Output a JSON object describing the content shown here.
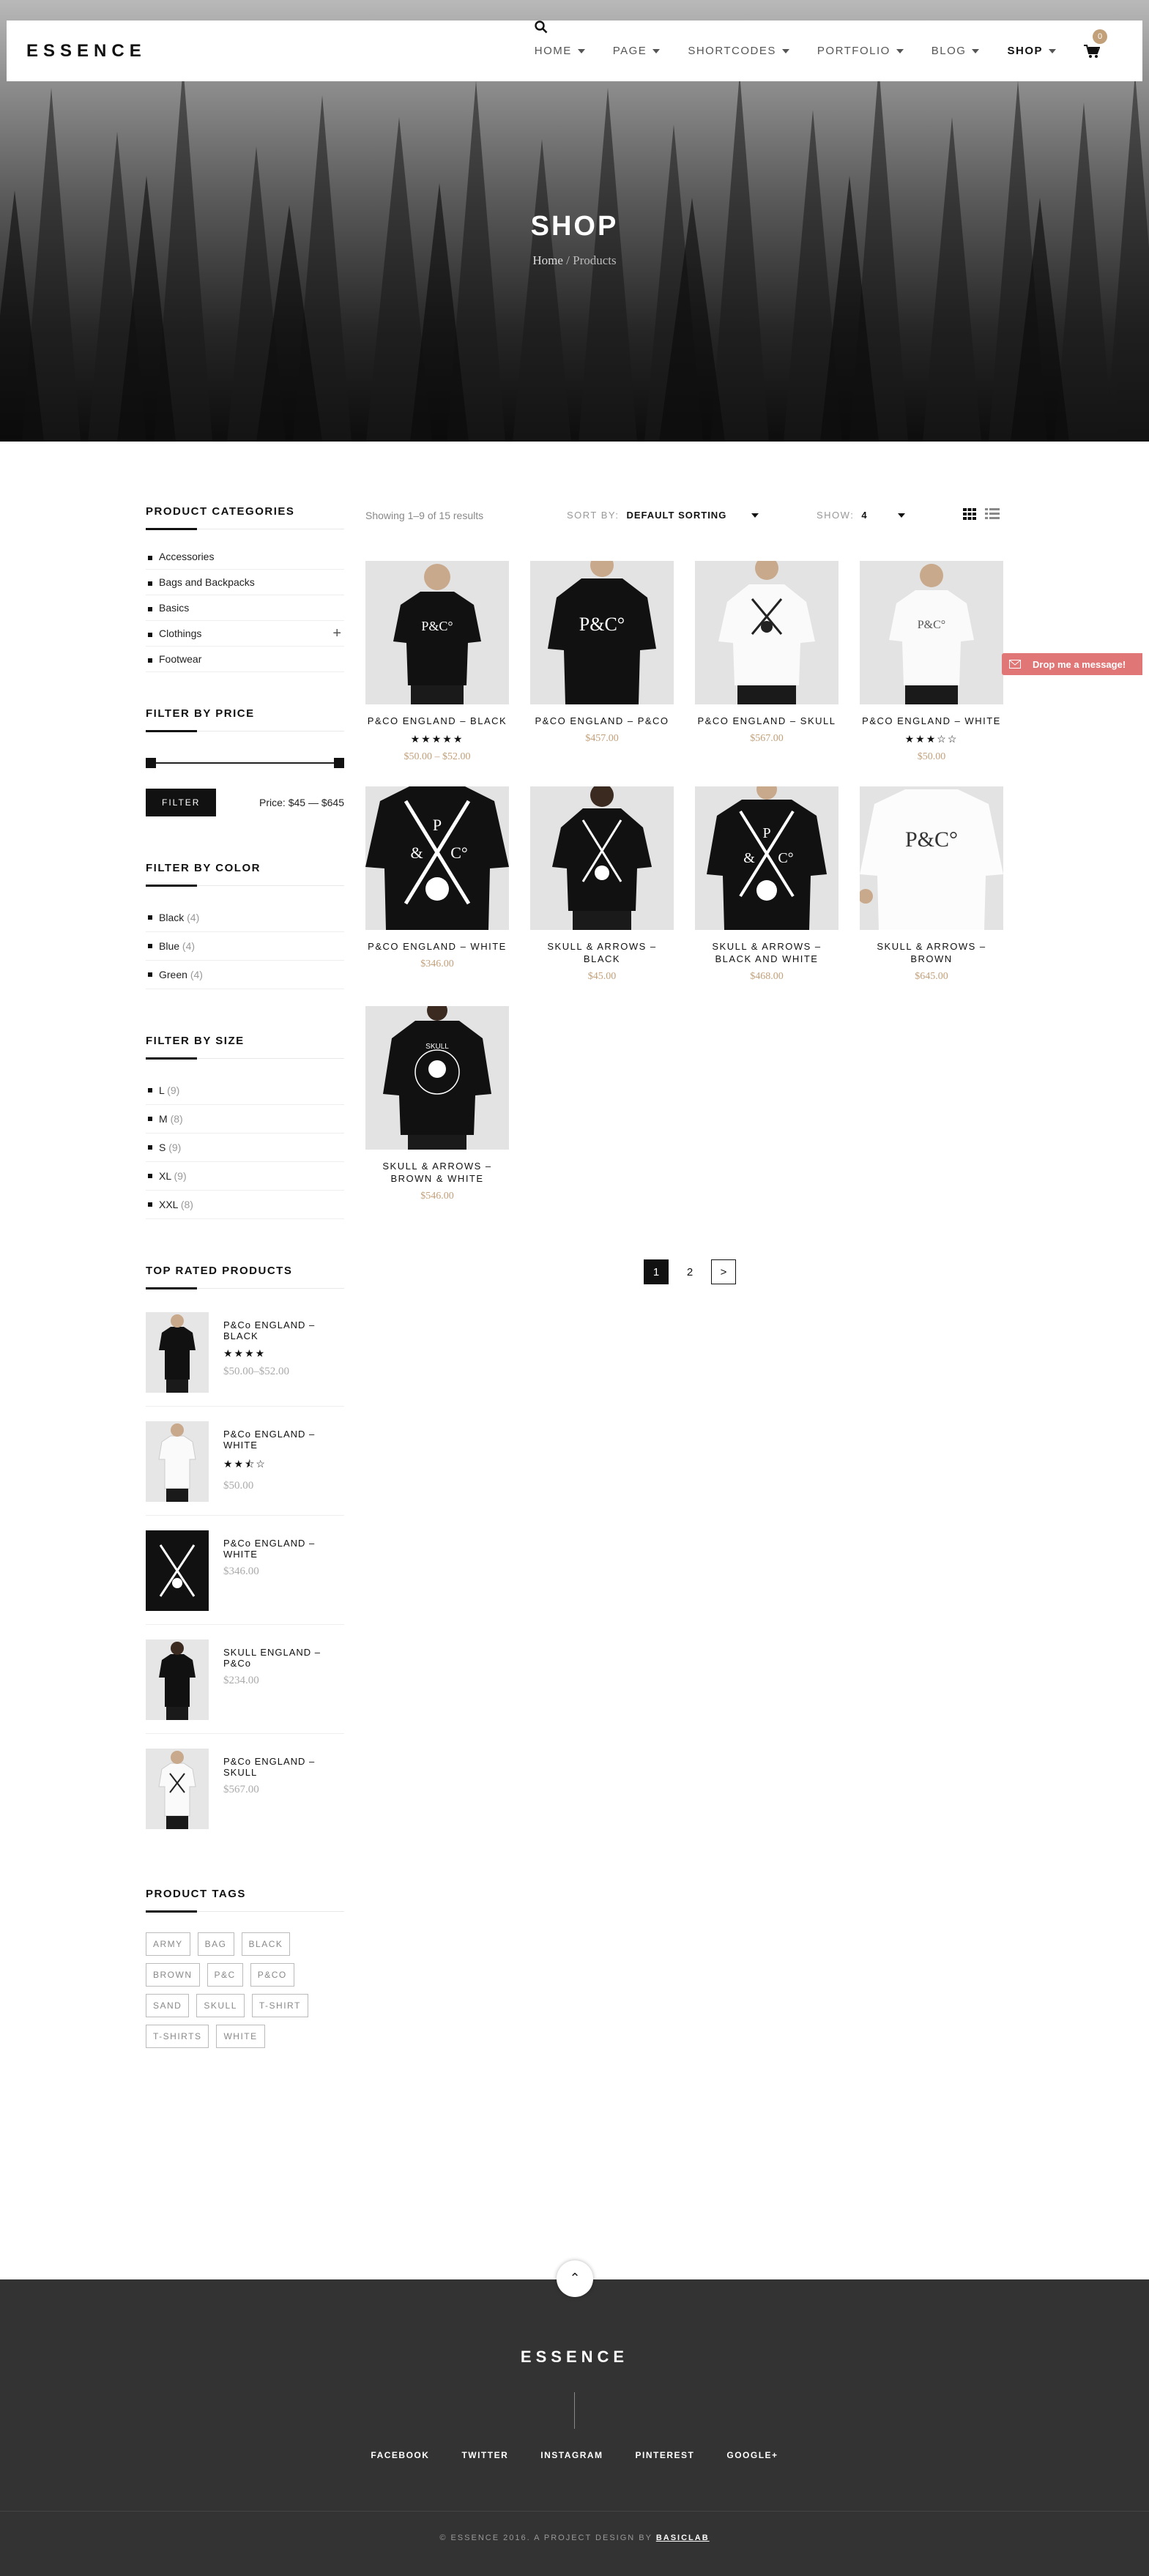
{
  "header": {
    "logo": "ESSENCE",
    "nav": [
      {
        "label": "HOME"
      },
      {
        "label": "PAGE"
      },
      {
        "label": "SHORTCODES"
      },
      {
        "label": "PORTFOLIO"
      },
      {
        "label": "BLOG"
      },
      {
        "label": "SHOP"
      }
    ],
    "cart_count": "0"
  },
  "hero": {
    "title": "SHOP",
    "breadcrumb_home": "Home",
    "breadcrumb_sep": "/",
    "breadcrumb_current": "Products"
  },
  "sidebar": {
    "categories_title": "PRODUCT CATEGORIES",
    "categories": [
      "Accessories",
      "Bags and Backpacks",
      "Basics",
      "Clothings",
      "Footwear"
    ],
    "price_title": "FILTER BY PRICE",
    "filter_button": "FILTER",
    "price_range": "Price: $45 — $645",
    "color_title": "FILTER BY COLOR",
    "colors": [
      {
        "name": "Black",
        "count": "(4)"
      },
      {
        "name": "Blue",
        "count": "(4)"
      },
      {
        "name": "Green",
        "count": "(4)"
      }
    ],
    "size_title": "FILTER BY SIZE",
    "sizes": [
      {
        "name": "L",
        "count": "(9)"
      },
      {
        "name": "M",
        "count": "(8)"
      },
      {
        "name": "S",
        "count": "(9)"
      },
      {
        "name": "XL",
        "count": "(9)"
      },
      {
        "name": "XXL",
        "count": "(8)"
      }
    ],
    "top_rated_title": "TOP RATED PRODUCTS",
    "top_rated": [
      {
        "name": "P&Co ENGLAND – BLACK",
        "stars": "★★★★",
        "price": "$50.00–$52.00"
      },
      {
        "name": "P&Co ENGLAND – WHITE",
        "stars": "★★⯪☆",
        "price": "$50.00"
      },
      {
        "name": "P&Co ENGLAND – WHITE",
        "stars": "",
        "price": "$346.00"
      },
      {
        "name": "SKULL ENGLAND – P&Co",
        "stars": "",
        "price": "$234.00"
      },
      {
        "name": "P&Co ENGLAND – SKULL",
        "stars": "",
        "price": "$567.00"
      }
    ],
    "tags_title": "PRODUCT TAGS",
    "tags": [
      "ARMY",
      "BAG",
      "BLACK",
      "BROWN",
      "P&C",
      "P&CO",
      "SAND",
      "SKULL",
      "T-SHIRT",
      "T-SHIRTS",
      "WHITE"
    ]
  },
  "toolbar": {
    "results": "Showing 1–9 of 15 results",
    "sort_label": "SORT BY:",
    "sort_value": "DEFAULT SORTING",
    "show_label": "SHOW:",
    "show_value": "4"
  },
  "products": [
    {
      "name": "P&CO ENGLAND – BLACK",
      "stars": "★★★★★",
      "price": "$50.00 – $52.00"
    },
    {
      "name": "P&CO ENGLAND – P&CO",
      "stars": "",
      "price": "$457.00"
    },
    {
      "name": "P&CO ENGLAND – SKULL",
      "stars": "",
      "price": "$567.00"
    },
    {
      "name": "P&CO ENGLAND – WHITE",
      "stars": "★★★☆☆",
      "price": "$50.00"
    },
    {
      "name": "P&CO ENGLAND – WHITE",
      "stars": "",
      "price": "$346.00"
    },
    {
      "name": "SKULL & ARROWS – BLACK",
      "stars": "",
      "price": "$45.00"
    },
    {
      "name": "SKULL & ARROWS – BLACK AND WHITE",
      "stars": "",
      "price": "$468.00"
    },
    {
      "name": "SKULL & ARROWS – BROWN",
      "stars": "",
      "price": "$645.00"
    },
    {
      "name": "SKULL & ARROWS – BROWN & WHITE",
      "stars": "",
      "price": "$546.00"
    }
  ],
  "pagination": {
    "page1": "1",
    "page2": "2",
    "next": ">"
  },
  "chat": {
    "label": "Drop me a message!"
  },
  "footer": {
    "logo": "ESSENCE",
    "social": [
      "FACEBOOK",
      "TWITTER",
      "INSTAGRAM",
      "PINTEREST",
      "GOOGLE+"
    ],
    "copyright": "© ESSENCE 2016. A PROJECT DESIGN BY",
    "designer": "BASICLAB"
  },
  "colors": {
    "accent": "#c2a07a",
    "chat": "#e07676",
    "footer": "#333333"
  }
}
